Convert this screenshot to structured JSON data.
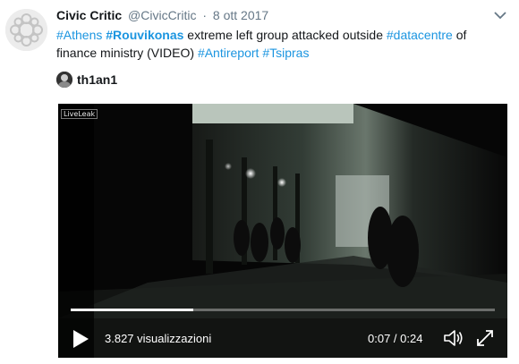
{
  "tweet": {
    "author_name": "Civic Critic",
    "handle": "@CivicCritic",
    "separator": "·",
    "date": "8 ott 2017",
    "text_parts": [
      {
        "text": "#Athens",
        "type": "hashtag"
      },
      {
        "text": " ",
        "type": "plain"
      },
      {
        "text": "#Rouvikonas",
        "type": "hashtag-bold"
      },
      {
        "text": " extreme left group attacked outside ",
        "type": "plain"
      },
      {
        "text": "#datacentre",
        "type": "hashtag"
      },
      {
        "text": " of finance ministry (VIDEO) ",
        "type": "plain"
      },
      {
        "text": "#Antireport",
        "type": "hashtag"
      },
      {
        "text": " ",
        "type": "plain"
      },
      {
        "text": "#Tsipras",
        "type": "hashtag"
      }
    ],
    "mention_name": "th1an1"
  },
  "video": {
    "watermark": "LiveLeak",
    "views": "3.827 visualizzazioni",
    "time": "0:07 / 0:24",
    "progress_fraction": 0.29
  },
  "colors": {
    "hashtag": "#1b95e0",
    "text": "#14171a",
    "muted": "#657786"
  },
  "icons": {
    "caret": "chevron-down-icon",
    "play": "play-icon",
    "volume": "volume-icon",
    "fullscreen": "fullscreen-icon"
  }
}
